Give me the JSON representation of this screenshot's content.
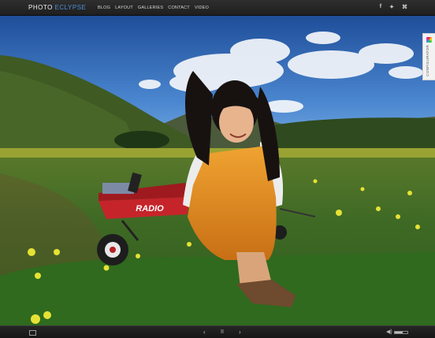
{
  "header": {
    "logo_part1": "PHOTO",
    "logo_part2": "ECLYPSE",
    "nav": [
      "BLOG",
      "LAYOUT",
      "GALLERIES",
      "CONTACT",
      "VIDEO"
    ],
    "social": [
      {
        "name": "facebook-icon",
        "glyph": "f"
      },
      {
        "name": "twitter-icon",
        "glyph": "✦"
      },
      {
        "name": "rss-icon",
        "glyph": "⌘"
      }
    ]
  },
  "slide": {
    "wagon_text": "RADIO",
    "subject": "photo-slide"
  },
  "configurator": {
    "label": "CONFIGURATOR"
  },
  "controls": {
    "prev_glyph": "‹",
    "pause_glyph": "II",
    "next_glyph": "›",
    "volume_glyph": "◀)",
    "volume_level": 0.6
  },
  "colors": {
    "accent": "#4f8fd6",
    "bar": "#1f1f1f"
  }
}
